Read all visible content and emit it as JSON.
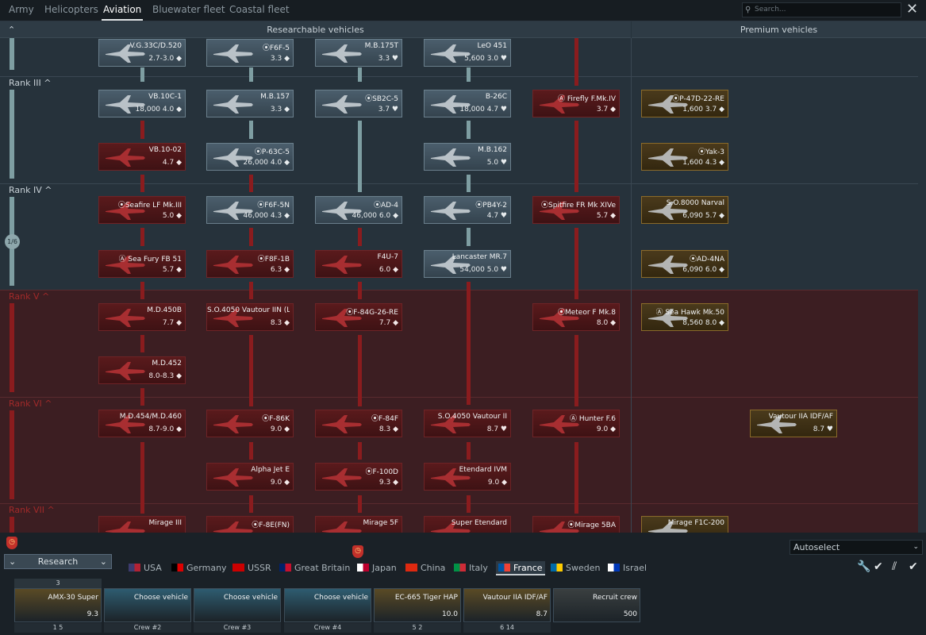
{
  "tabs": [
    "Army",
    "Helicopters",
    "Aviation",
    "Bluewater fleet",
    "Coastal fleet"
  ],
  "active_tab": "Aviation",
  "search": {
    "placeholder": "Search..."
  },
  "headers": {
    "researchable": "Researchable vehicles",
    "premium": "Premium vehicles"
  },
  "ranks": {
    "r3": "Rank III ^",
    "r4": "Rank IV ^",
    "r5": "Rank V ^",
    "r6": "Rank VI ^",
    "r7": "Rank VII ^"
  },
  "progress_badge": "1/6",
  "cards": [
    {
      "name": "V.G.33C/D.520",
      "br": "2.7-3.0 ◆",
      "cost": "",
      "state": "res"
    },
    {
      "name": "⦿F6F-5",
      "br": "3.3 ◆",
      "cost": "",
      "state": "res"
    },
    {
      "name": "M.B.175T",
      "br": "3.3 ♥",
      "cost": "",
      "state": "res"
    },
    {
      "name": "LeO 451",
      "br": "5,600 3.0 ♥",
      "cost": "",
      "state": "res"
    },
    {
      "name": "VB.10C-1",
      "br": "18,000 4.0 ◆",
      "cost": "",
      "state": "res"
    },
    {
      "name": "M.B.157",
      "br": "3.3 ◆",
      "cost": "",
      "state": "res"
    },
    {
      "name": "⦿SB2C-5",
      "br": "3.7 ♥",
      "cost": "",
      "state": "res"
    },
    {
      "name": "B-26C",
      "br": "18,000 4.7 ♥",
      "cost": "",
      "state": "res"
    },
    {
      "name": "Ⓐ Firefly F.Mk.IV",
      "br": "3.7 ◆",
      "cost": "",
      "state": "lock"
    },
    {
      "name": "⦿P-47D-22-RE",
      "br": "1,600 3.7 ◆",
      "cost": "",
      "state": "prem"
    },
    {
      "name": "VB.10-02",
      "br": "4.7 ◆",
      "cost": "",
      "state": "lock"
    },
    {
      "name": "⦿P-63C-5",
      "br": "26,000 4.0 ◆",
      "cost": "",
      "state": "res"
    },
    {
      "name": "M.B.162",
      "br": "5.0 ♥",
      "cost": "",
      "state": "res"
    },
    {
      "name": "⦿Yak-3",
      "br": "1,600 4.3 ◆",
      "cost": "",
      "state": "prem"
    },
    {
      "name": "⦿Seafire LF Mk.III",
      "br": "5.0 ◆",
      "cost": "",
      "state": "lock"
    },
    {
      "name": "⦿F6F-5N",
      "br": "46,000 4.3 ◆",
      "cost": "",
      "state": "res"
    },
    {
      "name": "⦿AD-4",
      "br": "46,000 6.0 ◆",
      "cost": "",
      "state": "res"
    },
    {
      "name": "⦿PB4Y-2",
      "br": "4.7 ♥",
      "cost": "",
      "state": "res"
    },
    {
      "name": "⦿Spitfire FR Mk XIVe",
      "br": "5.7 ◆",
      "cost": "",
      "state": "lock"
    },
    {
      "name": "S.O.8000 Narval",
      "br": "6,090 5.7 ◆",
      "cost": "",
      "state": "prem"
    },
    {
      "name": "Ⓐ Sea Fury FB 51",
      "br": "5.7 ◆",
      "cost": "",
      "state": "lock"
    },
    {
      "name": "⦿F8F-1B",
      "br": "6.3 ◆",
      "cost": "",
      "state": "lock"
    },
    {
      "name": "F4U-7",
      "br": "6.0 ◆",
      "cost": "",
      "state": "lock"
    },
    {
      "name": "Lancaster MR.7",
      "br": "54,000 5.0 ♥",
      "cost": "",
      "state": "res"
    },
    {
      "name": "⦿AD-4NA",
      "br": "6,090 6.0 ◆",
      "cost": "",
      "state": "prem"
    },
    {
      "name": "M.D.450B",
      "br": "7.7 ◆",
      "cost": "",
      "state": "lock"
    },
    {
      "name": "S.O.4050 Vautour IIN (Li",
      "br": "8.3 ◆",
      "cost": "",
      "state": "lock"
    },
    {
      "name": "⦿F-84G-26-RE",
      "br": "7.7 ◆",
      "cost": "",
      "state": "lock"
    },
    {
      "name": "⦿Meteor F Mk.8",
      "br": "8.0 ◆",
      "cost": "",
      "state": "lock"
    },
    {
      "name": "Ⓐ Sea Hawk Mk.50",
      "br": "8,560 8.0 ◆",
      "cost": "",
      "state": "prem"
    },
    {
      "name": "M.D.452",
      "br": "8.0-8.3 ◆",
      "cost": "",
      "state": "lock"
    },
    {
      "name": "M.D.454/M.D.460",
      "br": "8.7-9.0 ◆",
      "cost": "",
      "state": "lock"
    },
    {
      "name": "⦿F-86K",
      "br": "9.0 ◆",
      "cost": "",
      "state": "lock"
    },
    {
      "name": "⦿F-84F",
      "br": "8.3 ◆",
      "cost": "",
      "state": "lock"
    },
    {
      "name": "S.O.4050 Vautour II",
      "br": "8.7 ♥",
      "cost": "",
      "state": "lock"
    },
    {
      "name": "Ⓐ Hunter F.6",
      "br": "9.0 ◆",
      "cost": "",
      "state": "lock"
    },
    {
      "name": "Vautour IIA IDF/AF",
      "br": "8.7 ♥",
      "cost": "",
      "state": "prem"
    },
    {
      "name": "Alpha Jet E",
      "br": "9.0 ◆",
      "cost": "",
      "state": "lock"
    },
    {
      "name": "⦿F-100D",
      "br": "9.3 ◆",
      "cost": "",
      "state": "lock"
    },
    {
      "name": "Etendard IVM",
      "br": "9.0 ◆",
      "cost": "",
      "state": "lock"
    },
    {
      "name": "Mirage III",
      "br": "",
      "cost": "",
      "state": "lock"
    },
    {
      "name": "⦿F-8E(FN)",
      "br": "",
      "cost": "",
      "state": "lock"
    },
    {
      "name": "Mirage 5F",
      "br": "",
      "cost": "",
      "state": "lock"
    },
    {
      "name": "Super Etendard",
      "br": "",
      "cost": "",
      "state": "lock"
    },
    {
      "name": "⦿Mirage 5BA",
      "br": "",
      "cost": "",
      "state": "lock"
    },
    {
      "name": "Mirage F1C-200",
      "br": "",
      "cost": "",
      "state": "prem"
    }
  ],
  "autoselect": "Autoselect",
  "research_label": "Research",
  "nations": [
    "USA",
    "Germany",
    "USSR",
    "Great Britain",
    "Japan",
    "China",
    "Italy",
    "France",
    "Sweden",
    "Israel"
  ],
  "active_nation": "France",
  "crew_slots": [
    {
      "label": "AMX-30 Super",
      "br": "9.3",
      "foot": "1    5"
    },
    {
      "label": "Choose vehicle",
      "br": "",
      "foot": "Crew #2"
    },
    {
      "label": "Choose vehicle",
      "br": "",
      "foot": "Crew #3"
    },
    {
      "label": "Choose vehicle",
      "br": "",
      "foot": "Crew #4"
    },
    {
      "label": "EC-665 Tiger HAP",
      "br": "10.0",
      "foot": "5    2"
    },
    {
      "label": "Vautour IIA IDF/AF",
      "br": "8.7",
      "foot": "6    14"
    },
    {
      "label": "Recruit crew",
      "br": "500",
      "foot": ""
    }
  ],
  "slot_top_badge": "3"
}
